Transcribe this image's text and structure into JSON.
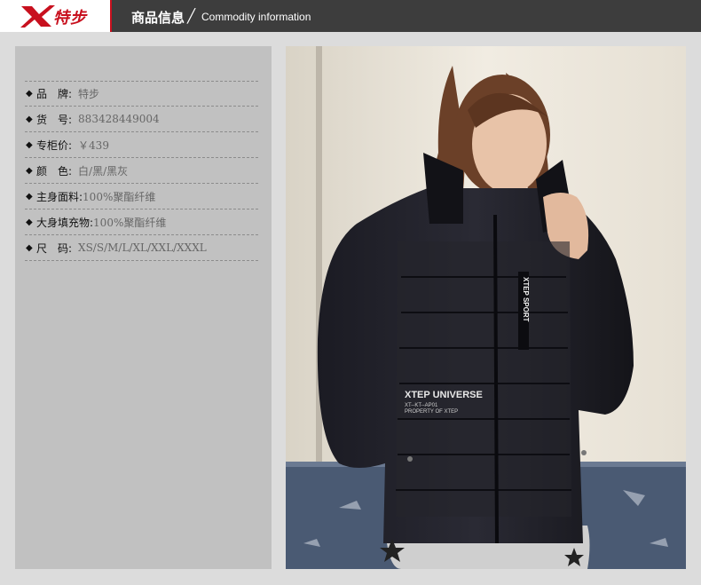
{
  "header": {
    "logo_text": "特步",
    "title": "商品信息",
    "separator": "╱",
    "subtitle": "Commodity information"
  },
  "info": {
    "rows": [
      {
        "label": "品　牌:",
        "value": "特步"
      },
      {
        "label": "货　号:",
        "value": "883428449004"
      },
      {
        "label": "专柜价:",
        "value": "￥439"
      },
      {
        "label": "颜　色:",
        "value": "白/黑/黑灰"
      },
      {
        "label": "主身面料:",
        "value": "100%聚酯纤维"
      },
      {
        "label": "大身填充物:",
        "value": "100%聚酯纤维"
      },
      {
        "label": "尺　码:",
        "value": "XS/S/M/L/XL/XXL/XXXL"
      }
    ]
  },
  "photo": {
    "tag_vertical": "XTEP SPORT",
    "tag_chest": "XTEP UNIVERSE",
    "tag_chest_small_1": "XT--KT--AP01",
    "tag_chest_small_2": "PROPERTY OF XTEP",
    "colors": {
      "jacket": "#16161d",
      "wall": "#ece6da",
      "hair": "#6b4028",
      "skin": "#e8c3a8"
    }
  }
}
